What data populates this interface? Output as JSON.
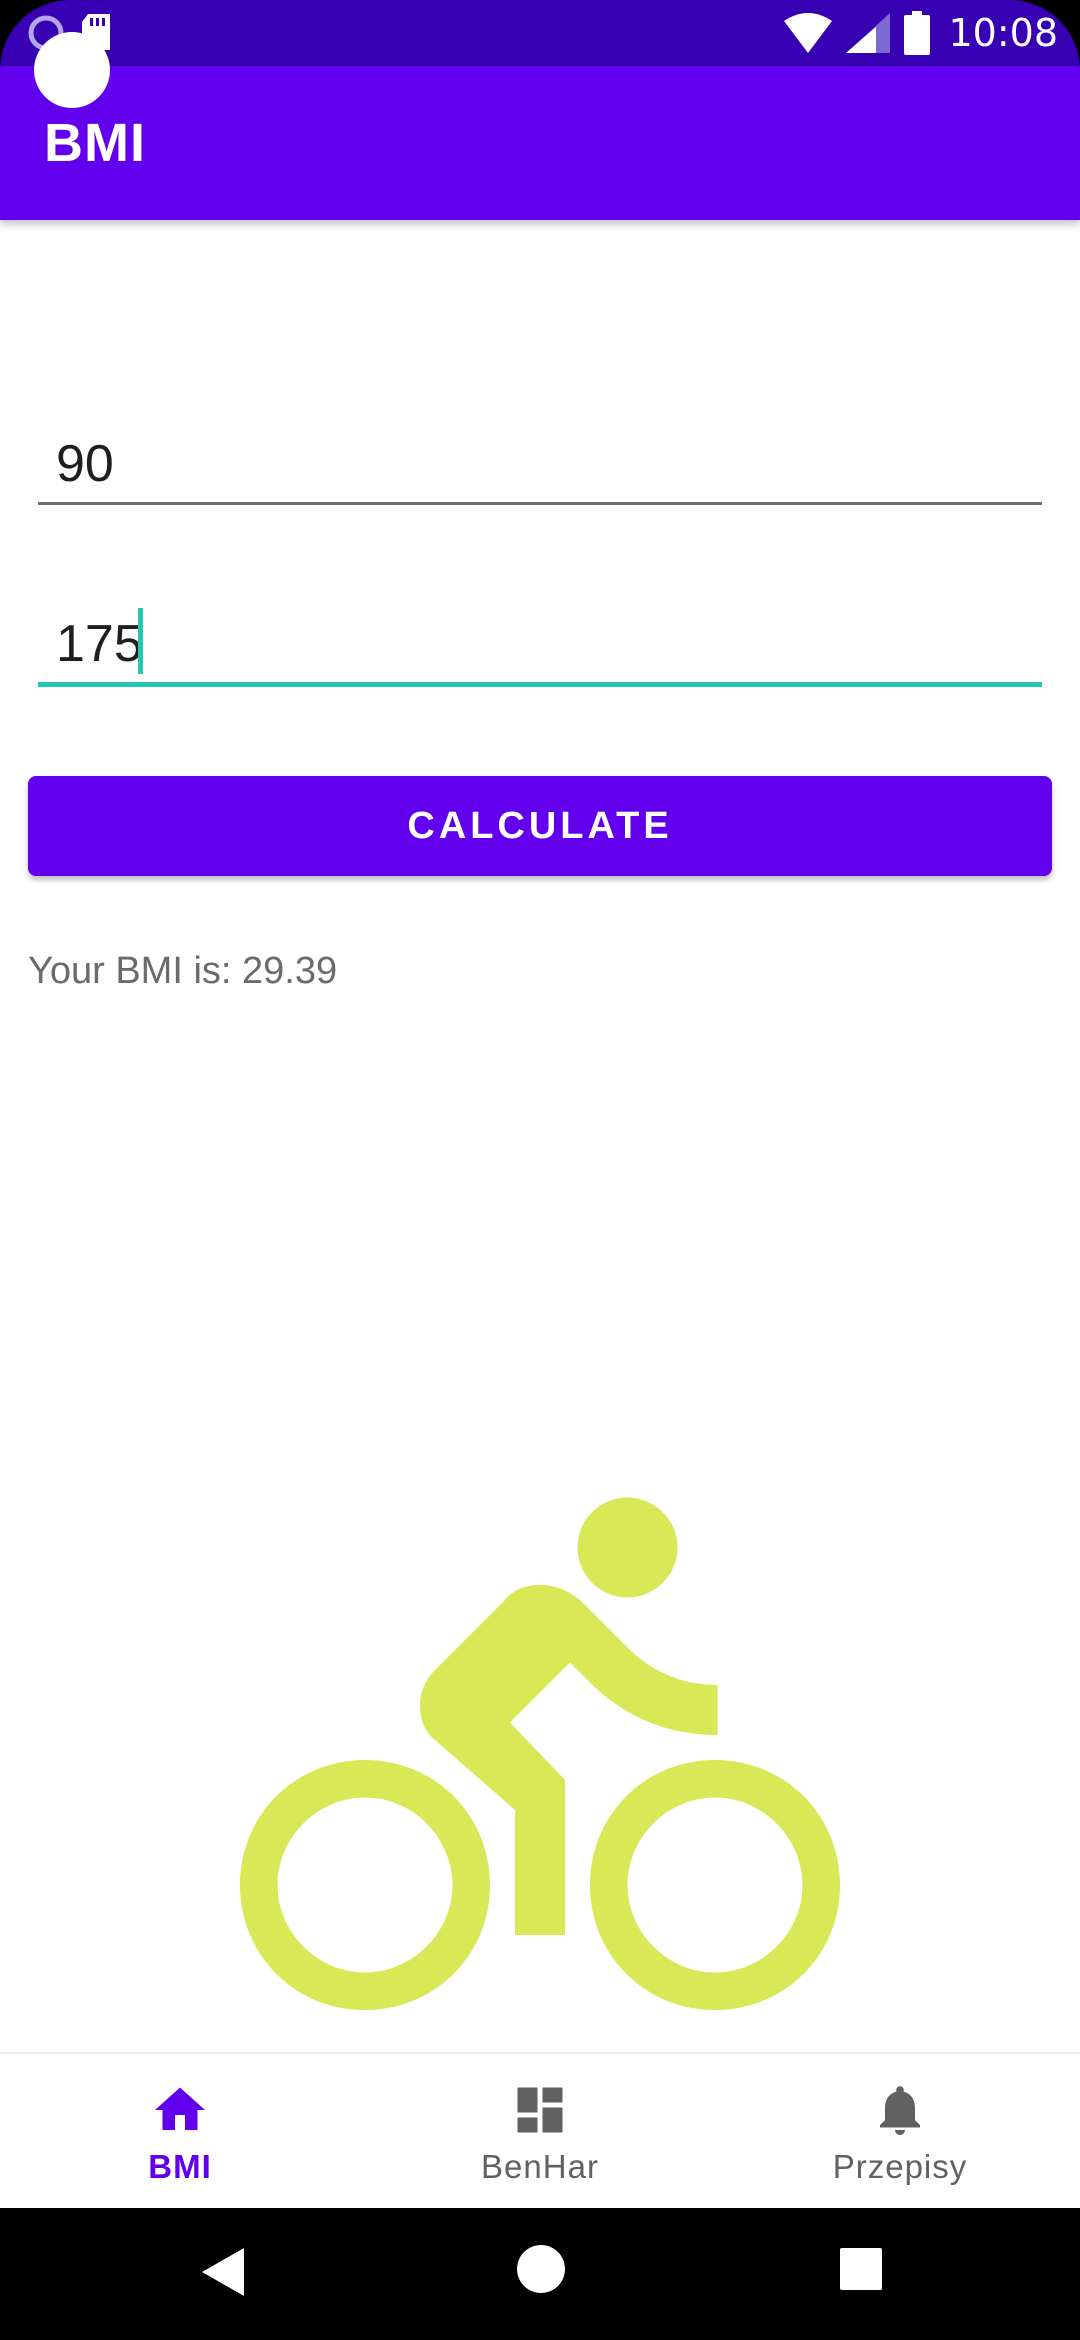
{
  "status_bar": {
    "time": "10:08",
    "background": "#3700b3",
    "icons": [
      "notification-icon",
      "sd-card-icon",
      "wifi-icon",
      "signal-icon",
      "battery-icon"
    ]
  },
  "app_bar": {
    "title": "BMI",
    "background": "#6200ee"
  },
  "form": {
    "weight_value": "90",
    "height_value": "175",
    "active_accent": "#26c6b5"
  },
  "calculate_button": {
    "label": "CALCULATE",
    "background": "#6200ee"
  },
  "result": {
    "text": "Your BMI is: 29.39"
  },
  "illustration": {
    "icon": "bike-icon",
    "color": "#d9e856"
  },
  "bottom_nav": {
    "items": [
      {
        "label": "BMI",
        "icon": "home-icon",
        "active": true
      },
      {
        "label": "BenHar",
        "icon": "dashboard-icon",
        "active": false
      },
      {
        "label": "Przepisy",
        "icon": "bell-icon",
        "active": false
      }
    ],
    "active_color": "#6200ee",
    "inactive_color": "#616161"
  },
  "system_nav": {
    "buttons": [
      "back-icon",
      "home-circle-icon",
      "recents-icon"
    ]
  }
}
